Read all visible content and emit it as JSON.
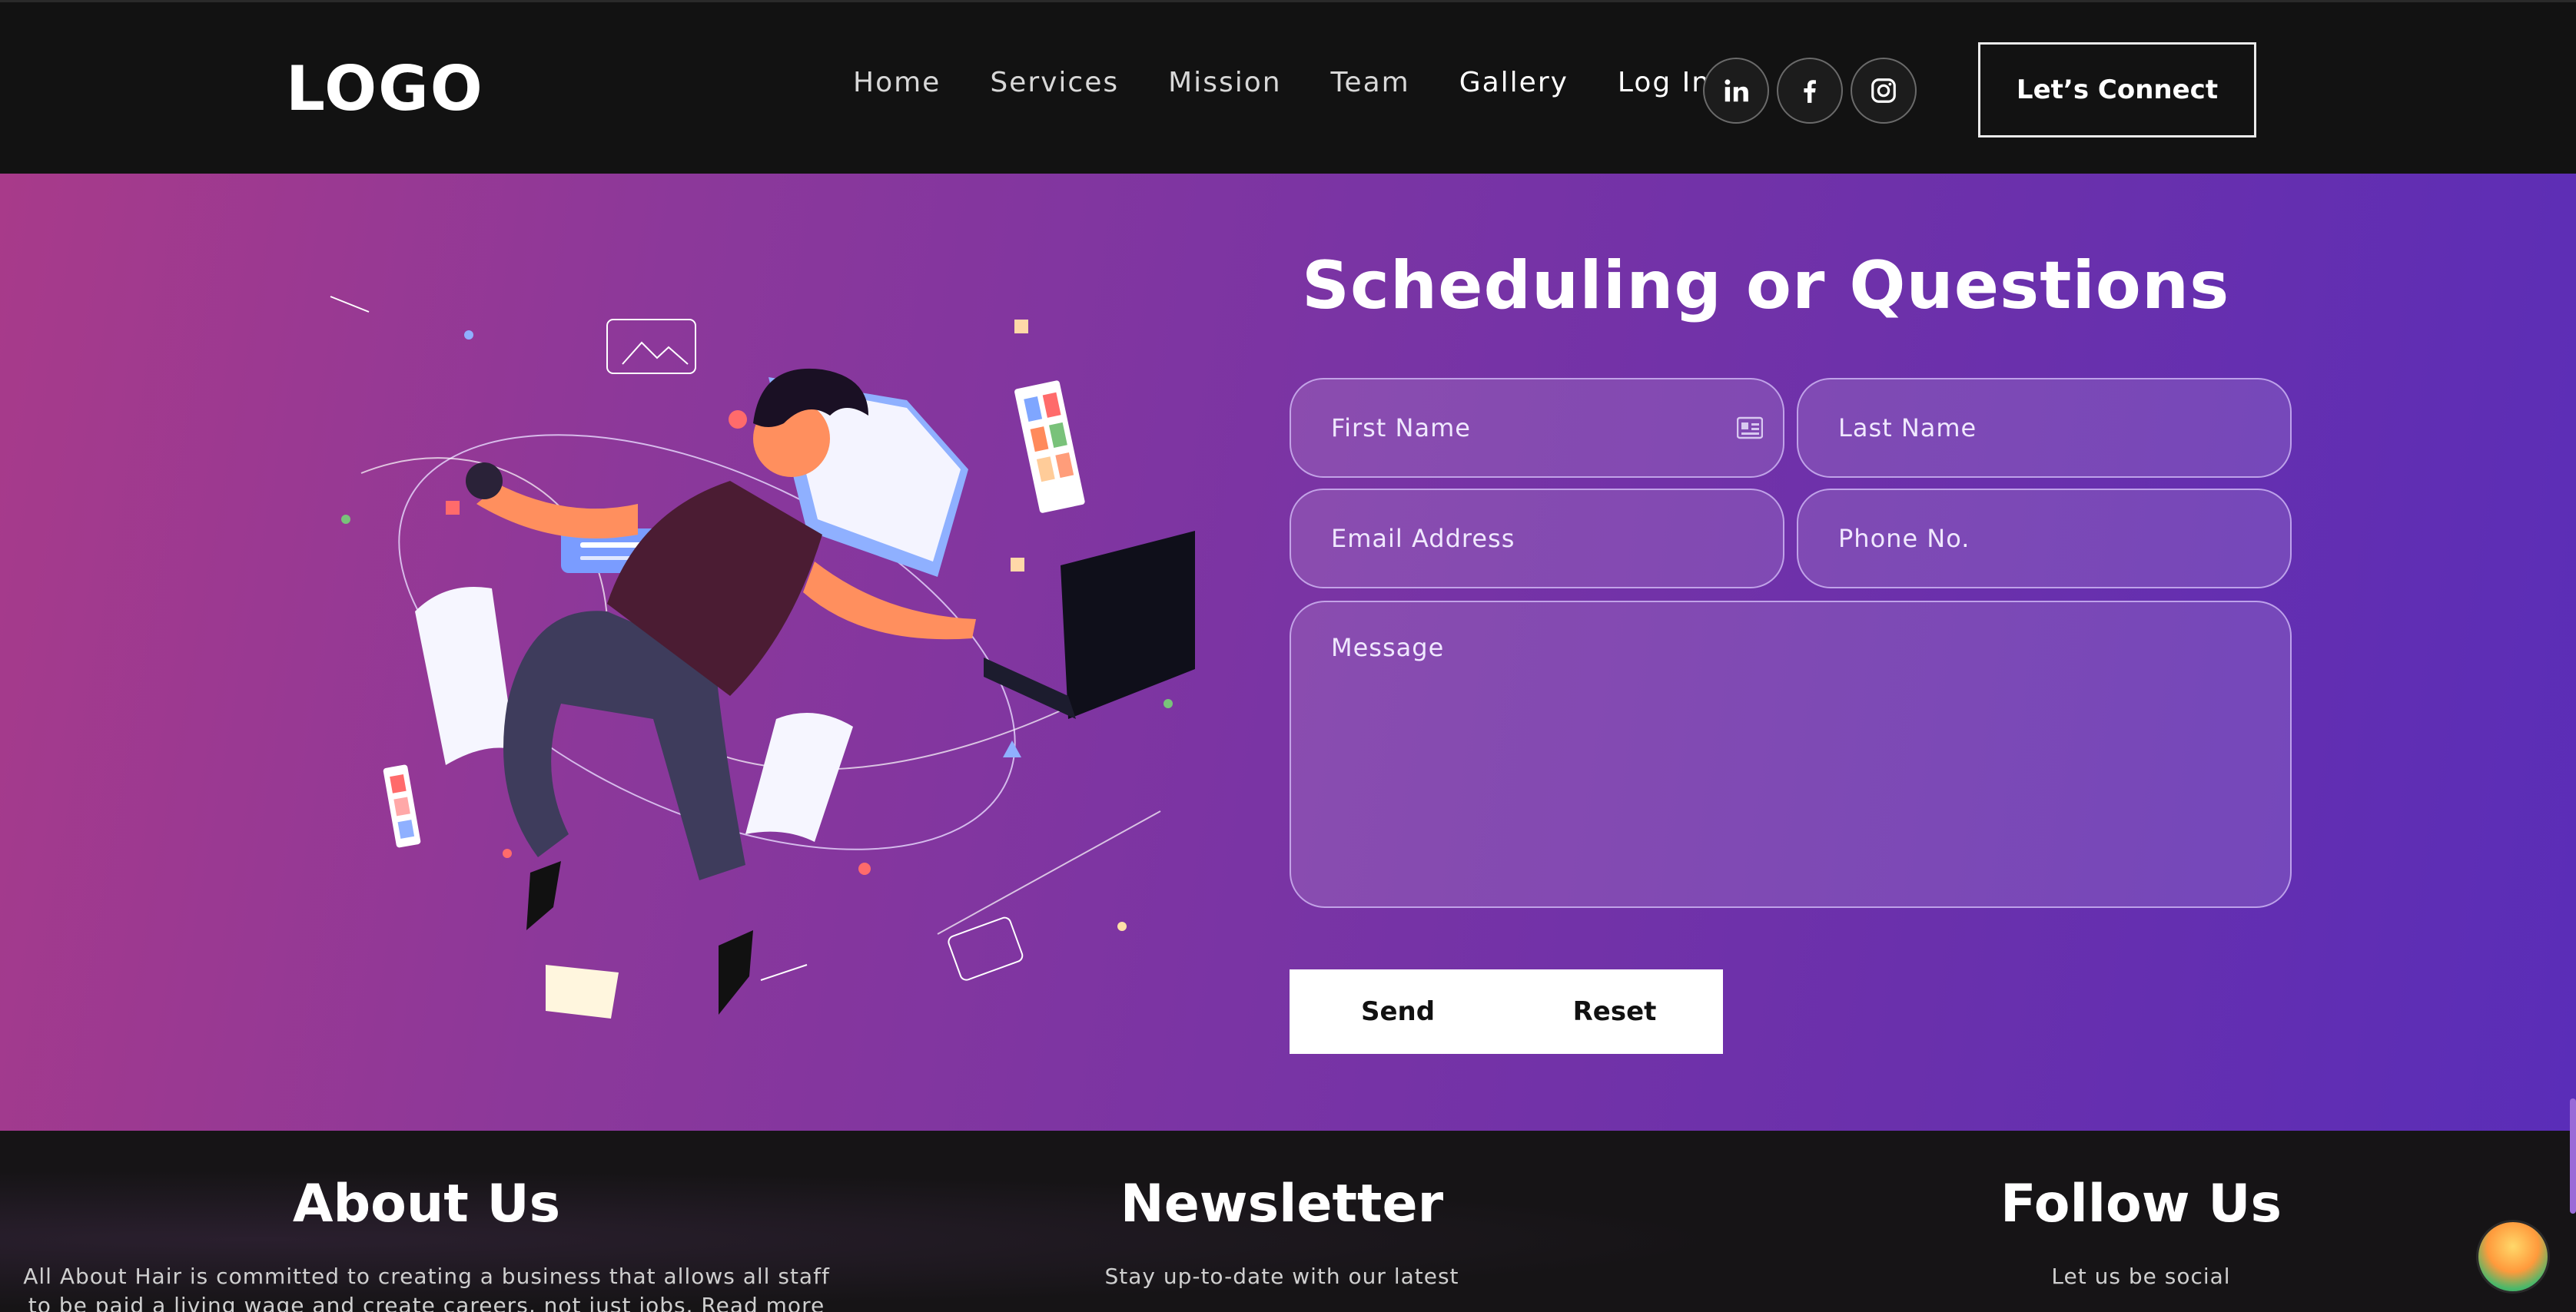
{
  "header": {
    "logo": "LOGO",
    "nav": [
      {
        "label": "Home"
      },
      {
        "label": "Services"
      },
      {
        "label": "Mission"
      },
      {
        "label": "Team"
      },
      {
        "label": "Gallery"
      },
      {
        "label": "Log In"
      }
    ],
    "socials": [
      {
        "icon": "linkedin-icon"
      },
      {
        "icon": "facebook-icon"
      },
      {
        "icon": "instagram-icon"
      }
    ],
    "cta_label": "Let’s Connect"
  },
  "form": {
    "title": "Scheduling or Questions",
    "first_name_placeholder": "First Name",
    "last_name_placeholder": "Last Name",
    "email_placeholder": "Email Address",
    "phone_placeholder": "Phone No.",
    "message_placeholder": "Message",
    "send_label": "Send",
    "reset_label": "Reset"
  },
  "footer": {
    "about": {
      "title": "About Us",
      "text": "All About Hair is committed to creating a business that allows all staff to be paid a living wage and create careers, not just jobs. Read more about our B"
    },
    "newsletter": {
      "title": "Newsletter",
      "text": "Stay up-to-date with our latest"
    },
    "follow": {
      "title": "Follow Us",
      "text": "Let us be social"
    }
  },
  "colors": {
    "header_bg": "#121212",
    "gradient_start": "#a83a8a",
    "gradient_end": "#5a2db8",
    "button_bg": "#ffffff"
  }
}
